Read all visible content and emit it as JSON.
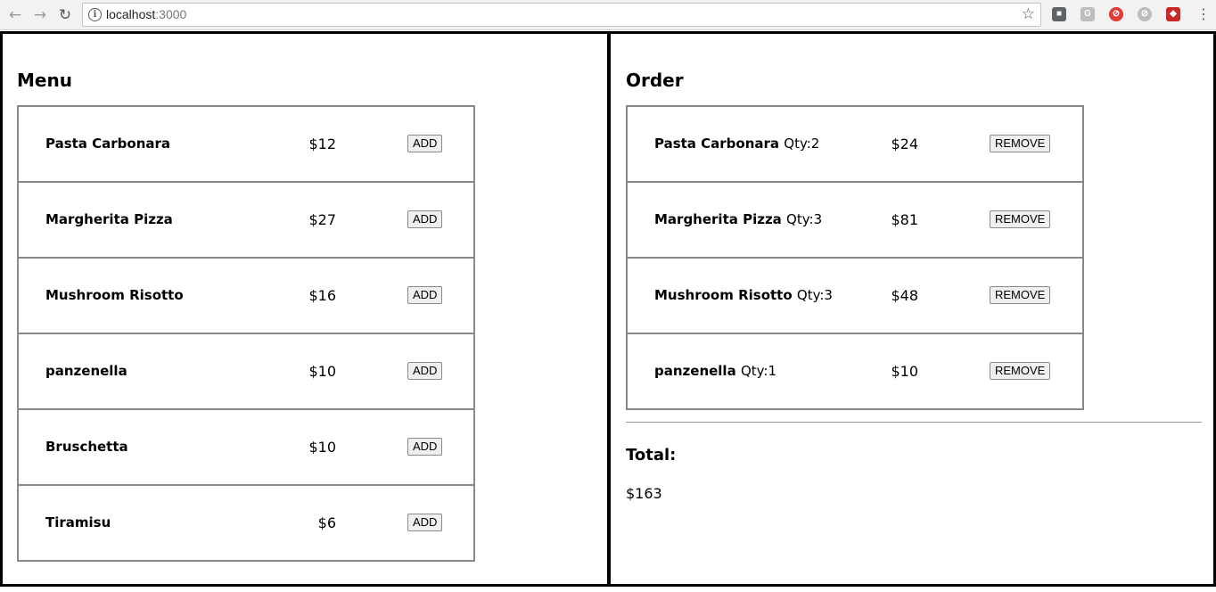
{
  "browser": {
    "url_host": "localhost",
    "url_port": ":3000",
    "back_icon": "arrow-left-icon",
    "forward_icon": "arrow-right-icon",
    "reload_icon": "reload-icon"
  },
  "menu": {
    "title": "Menu",
    "add_label": "ADD",
    "items": [
      {
        "name": "Pasta Carbonara",
        "price": "$12"
      },
      {
        "name": "Margherita Pizza",
        "price": "$27"
      },
      {
        "name": "Mushroom Risotto",
        "price": "$16"
      },
      {
        "name": "panzenella",
        "price": "$10"
      },
      {
        "name": "Bruschetta",
        "price": "$10"
      },
      {
        "name": "Tiramisu",
        "price": "$6"
      }
    ]
  },
  "order": {
    "title": "Order",
    "remove_label": "REMOVE",
    "items": [
      {
        "name": "Pasta Carbonara",
        "qty": "Qty:2",
        "price": "$24"
      },
      {
        "name": "Margherita Pizza",
        "qty": "Qty:3",
        "price": "$81"
      },
      {
        "name": "Mushroom Risotto",
        "qty": "Qty:3",
        "price": "$48"
      },
      {
        "name": "panzenella",
        "qty": "Qty:1",
        "price": "$10"
      }
    ],
    "total_label": "Total:",
    "total_value": "$163"
  }
}
